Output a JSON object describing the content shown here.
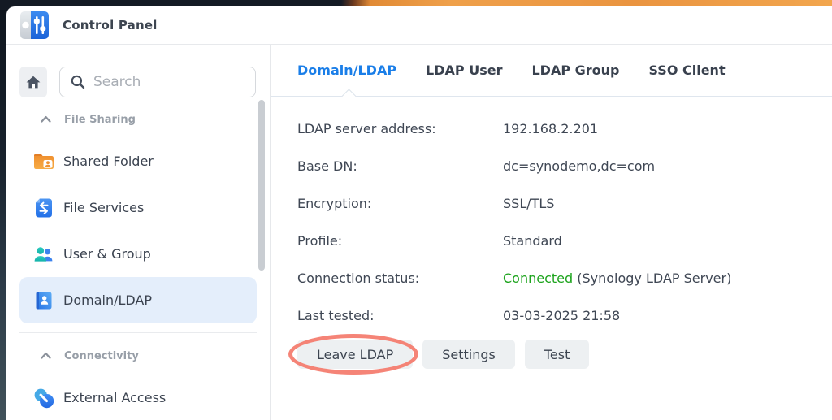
{
  "window": {
    "title": "Control Panel",
    "icon": "control-panel-icon"
  },
  "sidebar": {
    "home_icon": "home-icon",
    "search": {
      "placeholder": "Search",
      "icon": "search-icon"
    },
    "sections": [
      {
        "label": "File Sharing",
        "collapse_icon": "chevron-up-icon",
        "items": [
          {
            "label": "Shared Folder",
            "icon": "shared-folder-icon",
            "selected": false
          },
          {
            "label": "File Services",
            "icon": "file-services-icon",
            "selected": false
          },
          {
            "label": "User & Group",
            "icon": "user-group-icon",
            "selected": false
          },
          {
            "label": "Domain/LDAP",
            "icon": "domain-ldap-icon",
            "selected": true
          }
        ]
      },
      {
        "label": "Connectivity",
        "collapse_icon": "chevron-up-icon",
        "items": [
          {
            "label": "External Access",
            "icon": "external-access-icon",
            "selected": false
          }
        ]
      }
    ]
  },
  "main": {
    "tabs": [
      {
        "label": "Domain/LDAP",
        "active": true
      },
      {
        "label": "LDAP User",
        "active": false
      },
      {
        "label": "LDAP Group",
        "active": false
      },
      {
        "label": "SSO Client",
        "active": false
      }
    ],
    "fields": [
      {
        "label": "LDAP server address:",
        "value": "192.168.2.201"
      },
      {
        "label": "Base DN:",
        "value": "dc=synodemo,dc=com"
      },
      {
        "label": "Encryption:",
        "value": "SSL/TLS"
      },
      {
        "label": "Profile:",
        "value": "Standard"
      },
      {
        "label": "Connection status:",
        "value": "Connected",
        "value_suffix": " (Synology LDAP Server)",
        "status_color": "#1ea41e"
      },
      {
        "label": "Last tested:",
        "value": "03-03-2025 21:58"
      }
    ],
    "buttons": [
      {
        "label": "Leave LDAP",
        "annotated": true
      },
      {
        "label": "Settings",
        "annotated": false
      },
      {
        "label": "Test",
        "annotated": false
      }
    ],
    "annotation": {
      "shape": "ellipse",
      "color": "#f4796b",
      "target": "Leave LDAP"
    }
  },
  "colors": {
    "accent_blue": "#1a7ee8",
    "status_green": "#1ea41e",
    "annotation_red": "#f4796b",
    "selected_item_bg": "#e4eefb"
  }
}
